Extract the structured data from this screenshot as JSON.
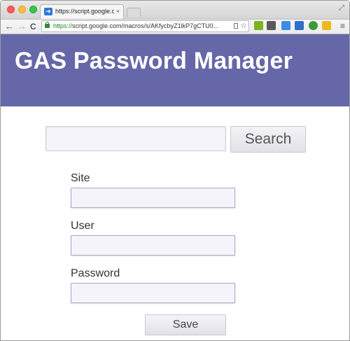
{
  "browser": {
    "tab": {
      "title": "https://script.google.com",
      "close": "×",
      "favicon": "arrow-favicon"
    },
    "nav": {
      "back": "←",
      "forward": "→",
      "reload": "C"
    },
    "address": {
      "scheme": "https://",
      "rest": "script.google.com/macros/s/AKfycbyZ1lkP7gCTU0..."
    },
    "icons": {
      "star": "☆",
      "menu": "≡",
      "fullscreen": "⤢"
    },
    "extensions": [
      {
        "name": "evernote-extension-icon",
        "color": "#7ab51d"
      },
      {
        "name": "clipboard-extension-icon",
        "color": "#5a5a5a"
      },
      {
        "name": "blue-extension-icon",
        "color": "#3a8ee6"
      },
      {
        "name": "screen-extension-icon",
        "color": "#2f6fc9"
      },
      {
        "name": "refresh-extension-icon",
        "color": "#3a9b3a"
      },
      {
        "name": "drive-extension-icon",
        "color": "#f1b81b"
      }
    ]
  },
  "app": {
    "title": "GAS Password Manager",
    "header_color": "#6567a8"
  },
  "search": {
    "value": "",
    "placeholder": "",
    "button_label": "Search"
  },
  "form": {
    "site_label": "Site",
    "site_value": "",
    "user_label": "User",
    "user_value": "",
    "password_label": "Password",
    "password_value": "",
    "save_label": "Save"
  }
}
